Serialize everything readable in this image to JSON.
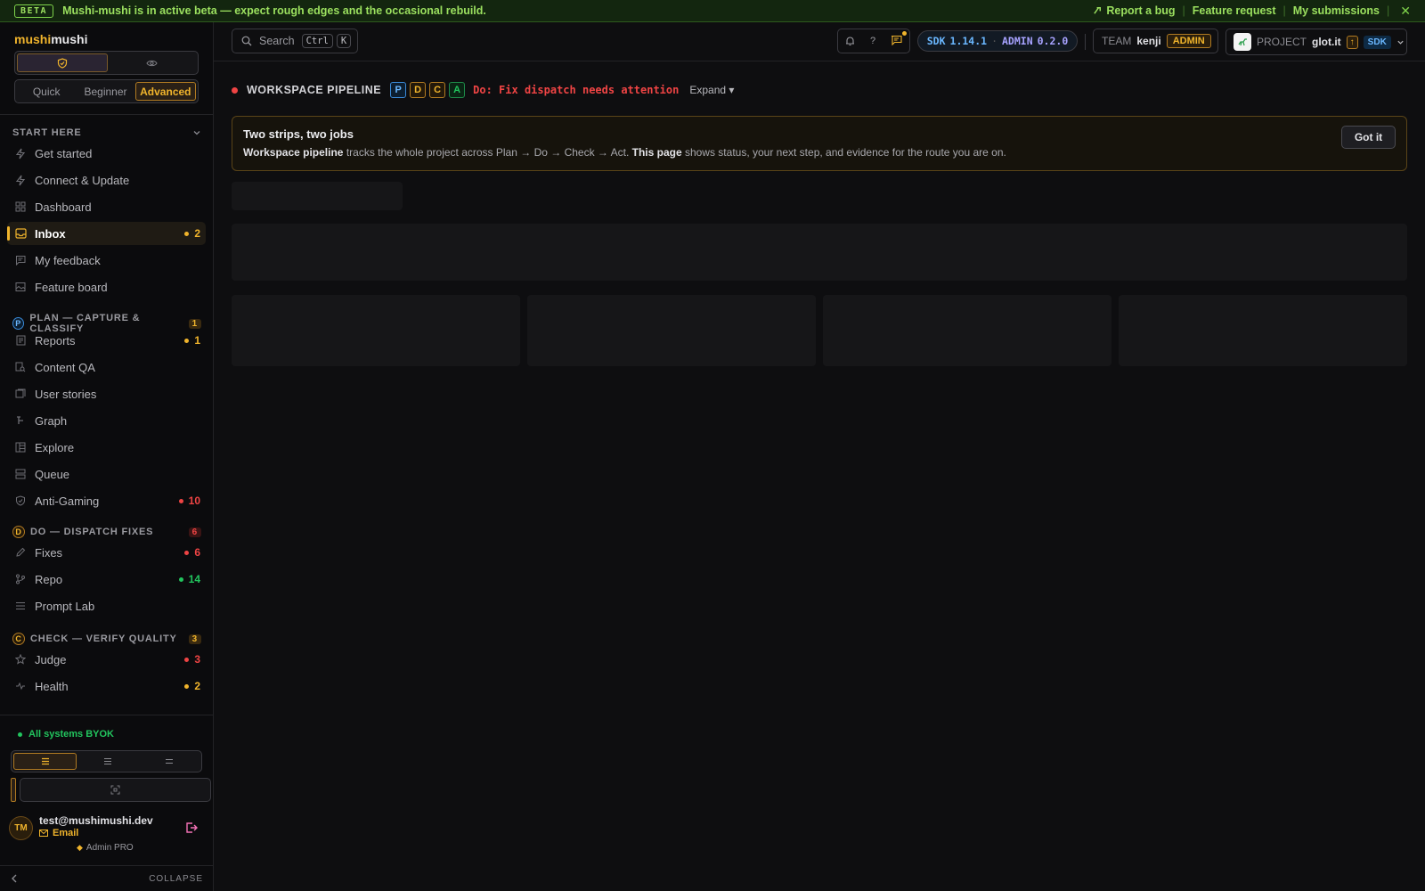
{
  "beta": {
    "tag": "BETA",
    "message": "Mushi-mushi is in active beta — expect rough edges and the occasional rebuild.",
    "links": [
      "Report a bug",
      "Feature request",
      "My submissions"
    ],
    "separator": "|",
    "close": "✕"
  },
  "brand": {
    "part1": "mushi",
    "part2": "mushi"
  },
  "level": {
    "options": [
      "Quick",
      "Beginner",
      "Advanced"
    ],
    "active": "Advanced"
  },
  "nav": {
    "start_here": "START HERE",
    "start_items": [
      {
        "label": "Get started"
      },
      {
        "label": "Connect & Update"
      },
      {
        "label": "Dashboard"
      },
      {
        "label": "Inbox",
        "count": "2"
      },
      {
        "label": "My feedback"
      },
      {
        "label": "Feature board"
      }
    ],
    "plan": {
      "letter": "P",
      "title": "PLAN — CAPTURE & CLASSIFY",
      "count": "1"
    },
    "plan_items": [
      {
        "label": "Reports",
        "count": "1"
      },
      {
        "label": "Content QA"
      },
      {
        "label": "User stories"
      },
      {
        "label": "Graph"
      },
      {
        "label": "Explore"
      },
      {
        "label": "Queue"
      },
      {
        "label": "Anti-Gaming",
        "count": "10"
      }
    ],
    "do": {
      "letter": "D",
      "title": "DO — DISPATCH FIXES",
      "count": "6"
    },
    "do_items": [
      {
        "label": "Fixes",
        "count": "6"
      },
      {
        "label": "Repo",
        "count": "14"
      },
      {
        "label": "Prompt Lab"
      }
    ],
    "check": {
      "letter": "C",
      "title": "CHECK — VERIFY QUALITY",
      "count": "3"
    },
    "check_items": [
      {
        "label": "Judge",
        "count": "3"
      },
      {
        "label": "Health",
        "count": "2"
      }
    ]
  },
  "status": "All systems BYOK",
  "user": {
    "initials": "TM",
    "email": "test@mushimushi.dev",
    "auth": "Email",
    "plan": "Admin PRO"
  },
  "collapse": "COLLAPSE",
  "topbar": {
    "search_label": "Search",
    "kbd1": "Ctrl",
    "kbd2": "K",
    "help": "?",
    "sdk_label": "SDK",
    "sdk_version": "1.14.1",
    "admin_label": "ADMIN",
    "admin_version": "0.2.0",
    "team_label": "TEAM",
    "team_name": "kenji",
    "team_role": "ADMIN",
    "project_label": "PROJECT",
    "project_name": "glot.it",
    "up_badge": "↑",
    "sdk_badge": "SDK"
  },
  "pipeline": {
    "title": "WORKSPACE PIPELINE",
    "letters": [
      "P",
      "D",
      "C",
      "A"
    ],
    "alert": "Do: Fix dispatch needs attention",
    "expand": "Expand ▾"
  },
  "callout": {
    "title": "Two strips, two jobs",
    "b1": "Workspace pipeline",
    "t1": " tracks the whole project across Plan → Do → Check → Act. ",
    "b2": "This page",
    "t2": " shows status, your next step, and evidence for the route you are on.",
    "button": "Got it"
  },
  "colors": {
    "accent": "#f0b42c",
    "danger": "#ef4444",
    "success": "#22c55e",
    "info": "#6ab7ff",
    "beta": "#9be05f"
  }
}
